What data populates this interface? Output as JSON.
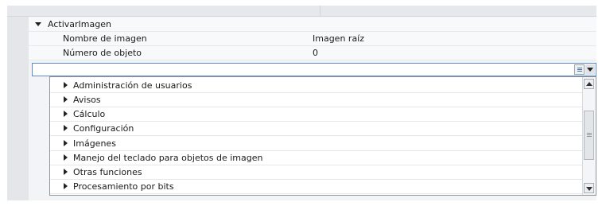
{
  "tree": {
    "group_label": "ActivarImagen",
    "params": [
      {
        "name": "Nombre de imagen",
        "value": "Imagen raíz"
      },
      {
        "name": "Número de objeto",
        "value": "0"
      }
    ]
  },
  "combo": {
    "value": "",
    "list_icon": "list-icon",
    "arrow_icon": "chevron-down-icon"
  },
  "dropdown": {
    "items": [
      "Administración de usuarios",
      "Avisos",
      "Cálculo",
      "Configuración",
      "Imágenes",
      "Manejo del teclado para objetos de imagen",
      "Otras funciones",
      "Procesamiento por bits"
    ],
    "scroll": {
      "position_fraction": 0.3
    }
  }
}
